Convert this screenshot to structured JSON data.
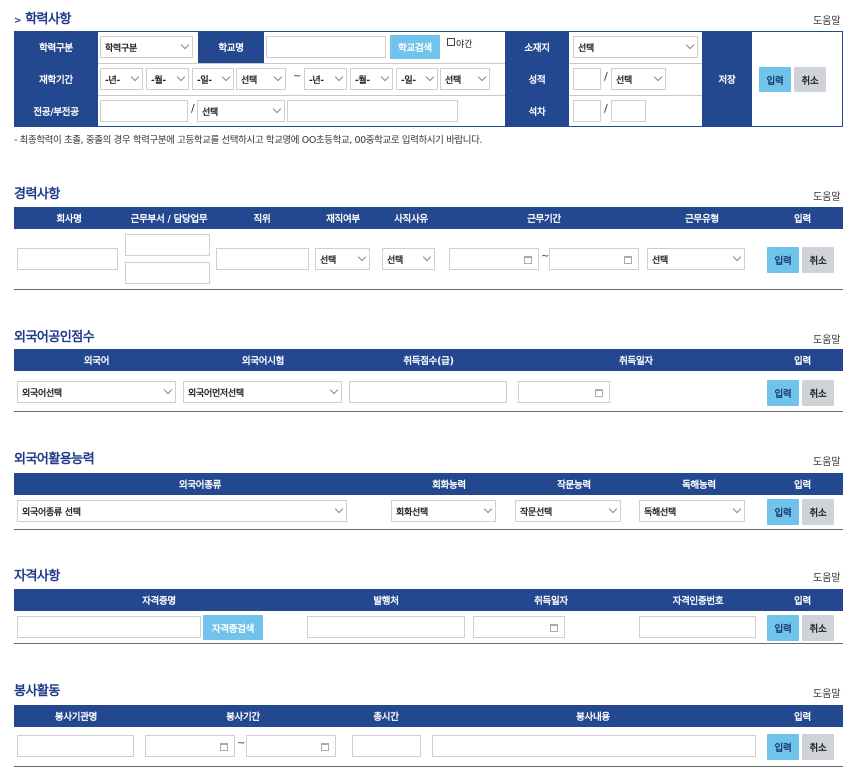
{
  "edu": {
    "title": "학력사항",
    "title_prefix": ">",
    "help": "도움말",
    "labels": {
      "type": "학력구분",
      "school": "학교명",
      "location": "소재지",
      "period": "재학기간",
      "grade": "성적",
      "major": "전공/부전공",
      "rank": "석차",
      "save": "저장"
    },
    "type_value": "학력구분",
    "search_btn": "학교검색",
    "night_label": "야간",
    "location_value": "선택",
    "year1": "-년-",
    "month1": "-월-",
    "day1": "-일-",
    "status1": "선택",
    "year2": "-년-",
    "month2": "-월-",
    "day2": "-일-",
    "status2": "선택",
    "tilde": "~",
    "grade_scale": "선택",
    "major_select": "선택",
    "input_btn": "입력",
    "cancel_btn": "취소",
    "note": "- 최종학력이 초졸, 중졸의 경우 학력구분에 고등학교를 선택하시고 학교명에 OO초등학교, 00중학교로 입력하시기 바랍니다."
  },
  "career": {
    "title": "경력사항",
    "help": "도움말",
    "headers": [
      "회사명",
      "근무부서 / 담당업무",
      "직위",
      "재직여부",
      "사직사유",
      "근무기간",
      "근무유형",
      "입력"
    ],
    "employed": "선택",
    "reason": "선택",
    "worktype": "선택",
    "tilde": "~",
    "input_btn": "입력",
    "cancel_btn": "취소"
  },
  "lang_score": {
    "title": "외국어공인점수",
    "help": "도움말",
    "headers": [
      "외국어",
      "외국어시험",
      "취득점수(급)",
      "취득일자",
      "입력"
    ],
    "lang_select": "외국어선택",
    "test_select": "외국어먼저선택",
    "input_btn": "입력",
    "cancel_btn": "취소"
  },
  "lang_ability": {
    "title": "외국어활용능력",
    "help": "도움말",
    "headers": [
      "외국어종류",
      "회화능력",
      "작문능력",
      "독해능력",
      "입력"
    ],
    "lang_select": "외국어종류 선택",
    "speak_select": "회화선택",
    "write_select": "작문선택",
    "read_select": "독해선택",
    "input_btn": "입력",
    "cancel_btn": "취소"
  },
  "cert": {
    "title": "자격사항",
    "help": "도움말",
    "headers": [
      "자격증명",
      "발행처",
      "취득일자",
      "자격인증번호",
      "입력"
    ],
    "search_btn": "자격증검색",
    "input_btn": "입력",
    "cancel_btn": "취소"
  },
  "volunteer": {
    "title": "봉사활동",
    "help": "도움말",
    "headers": [
      "봉사기관명",
      "봉사기간",
      "총시간",
      "봉사내용",
      "입력"
    ],
    "tilde": "~",
    "input_btn": "입력",
    "cancel_btn": "취소"
  }
}
